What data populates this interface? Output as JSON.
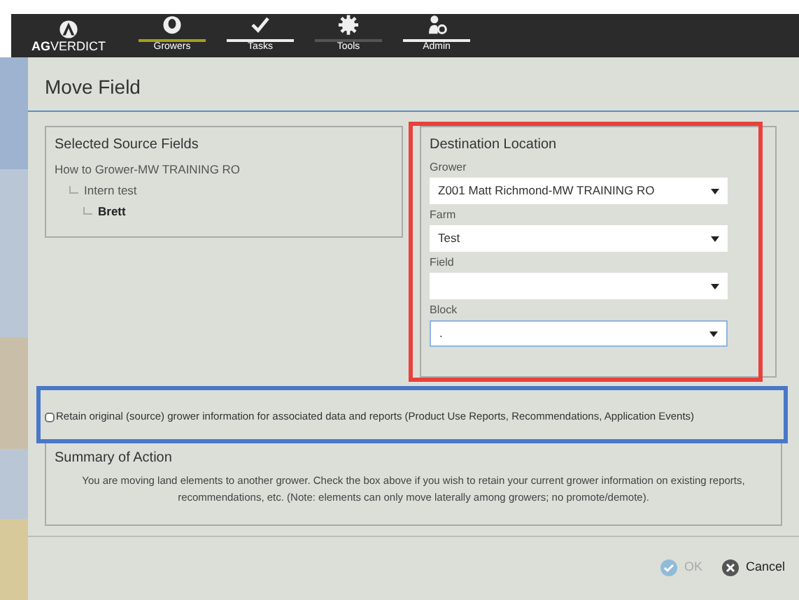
{
  "brand": {
    "prefix": "AG",
    "rest": "VERDICT"
  },
  "nav": [
    {
      "label": "Growers",
      "kind": "person",
      "color": "#a3a01a"
    },
    {
      "label": "Tasks",
      "kind": "check",
      "color": "#ececec"
    },
    {
      "label": "Tools",
      "kind": "gear",
      "color": "#555555"
    },
    {
      "label": "Admin",
      "kind": "admin",
      "color": "#ececec"
    }
  ],
  "dialog": {
    "title": "Move Field",
    "source": {
      "heading": "Selected Source Fields",
      "tree": [
        {
          "label": "How to Grower-MW TRAINING RO",
          "children": [
            {
              "label": "Intern test",
              "children": [
                {
                  "label": "Brett"
                }
              ]
            }
          ]
        }
      ]
    },
    "destination": {
      "heading": "Destination Location",
      "fields": [
        {
          "label": "Grower",
          "value": "Z001 Matt Richmond-MW TRAINING RO",
          "focused": false
        },
        {
          "label": "Farm",
          "value": "Test",
          "focused": false
        },
        {
          "label": "Field",
          "focused": false
        },
        {
          "label": "Block",
          "value": ".",
          "focused": true
        }
      ]
    },
    "retain": {
      "label": "Retain original (source) grower information for associated data and reports (Product Use Reports, Recommendations, Application Events)",
      "checked": false
    },
    "summary": {
      "heading": "Summary of Action",
      "text": "You are moving land elements to another grower. Check the box above if you wish to retain your current grower information on existing reports, recommendations, etc. (Note: elements can only move laterally among growers; no promote/demote)."
    },
    "buttons": [
      {
        "label": "OK",
        "kind": "ok",
        "disabled": true
      },
      {
        "label": "Cancel",
        "kind": "cancel",
        "disabled": false
      }
    ]
  },
  "annotations": [
    {
      "kind": "destination",
      "color": "#e8413c"
    },
    {
      "kind": "retain",
      "color": "#4a78c8"
    }
  ]
}
